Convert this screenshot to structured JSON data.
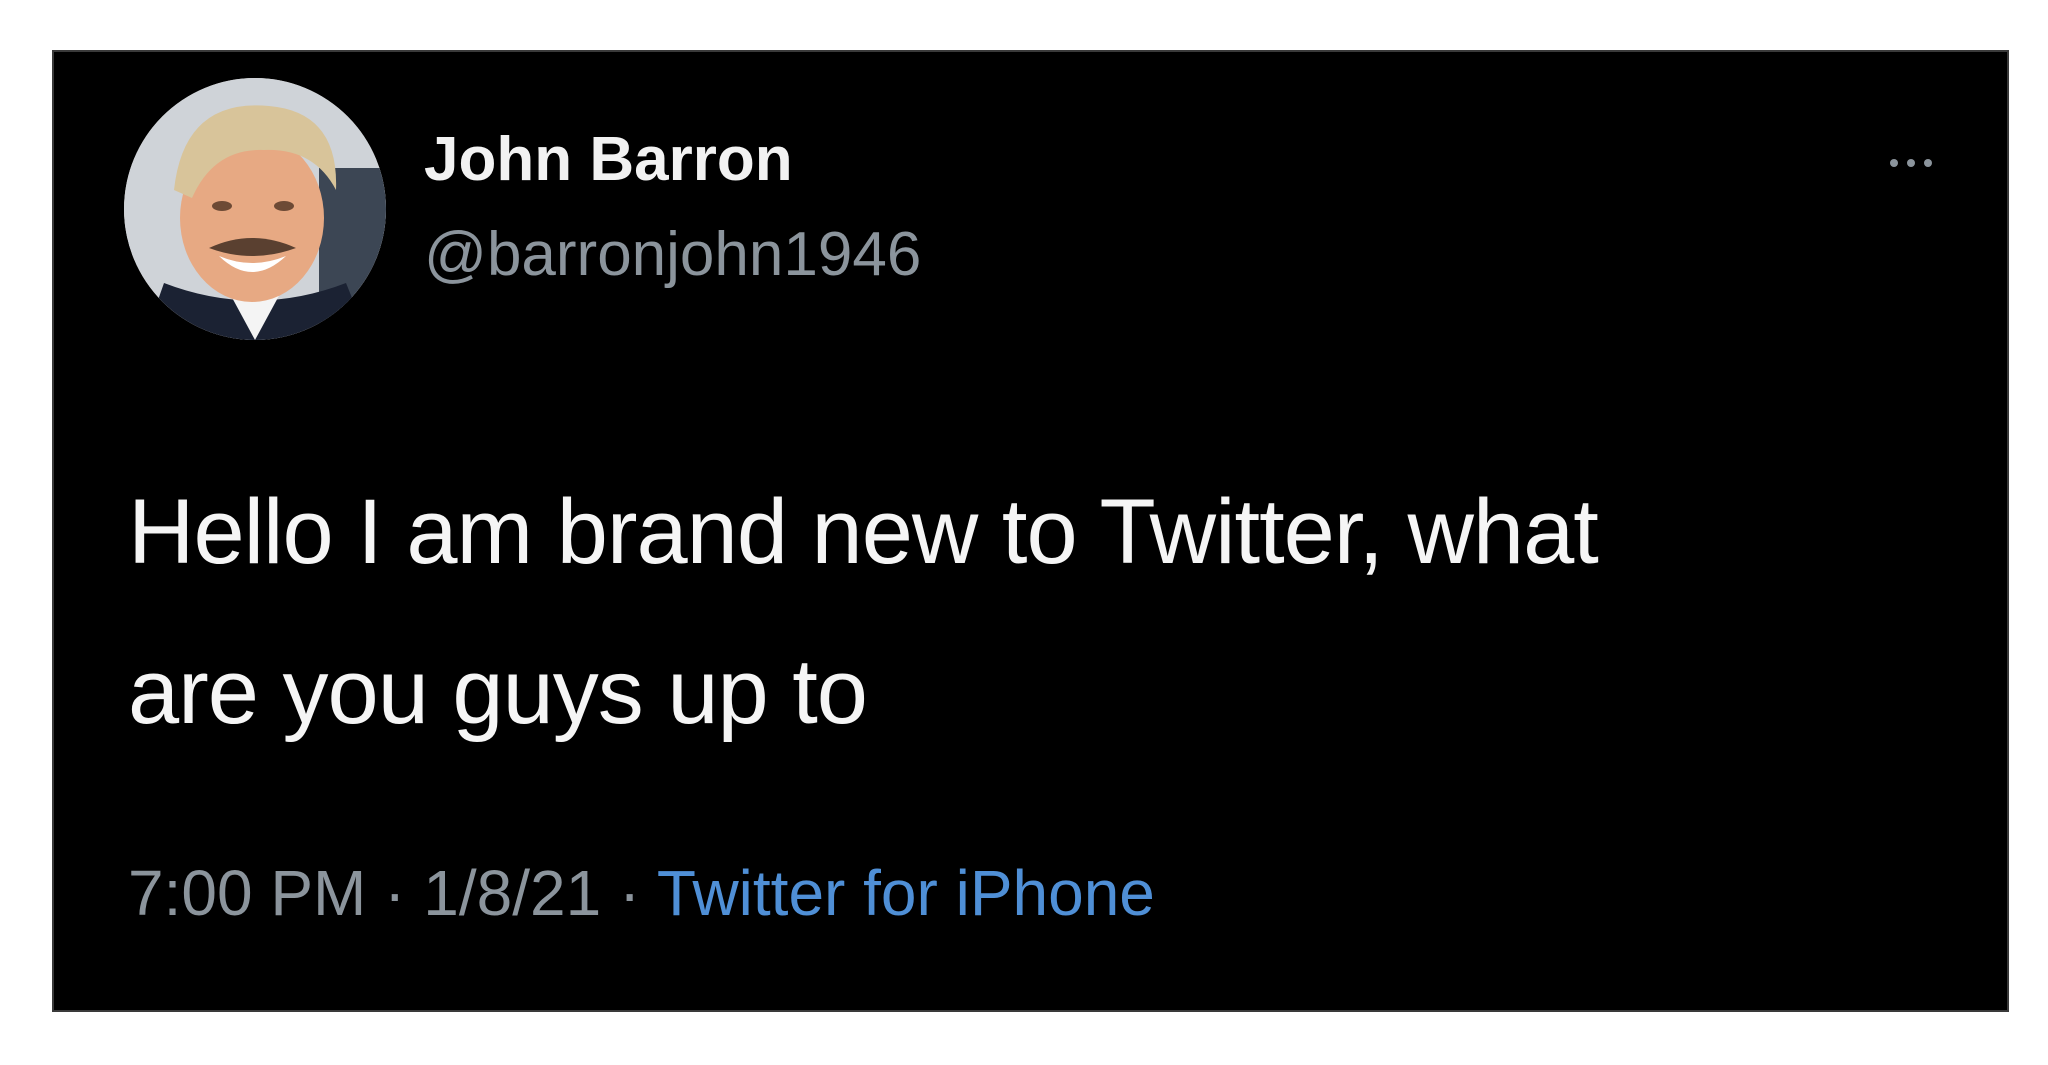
{
  "tweet": {
    "author": {
      "display_name": "John Barron",
      "handle": "@barronjohn1946",
      "avatar_icon": "profile-photo"
    },
    "more_icon": "more-options-icon",
    "text_line_1": "Hello I am brand new to Twitter, what",
    "text_line_2": "are you guys up to",
    "time": "7:00 PM",
    "date": "1/8/21",
    "separator": " · ",
    "source": "Twitter for iPhone"
  },
  "colors": {
    "card_background": "#000000",
    "name_text": "#f2f2f2",
    "secondary_text": "#8b949c",
    "body_text": "#f5f5f5",
    "link": "#4f8fd6"
  }
}
